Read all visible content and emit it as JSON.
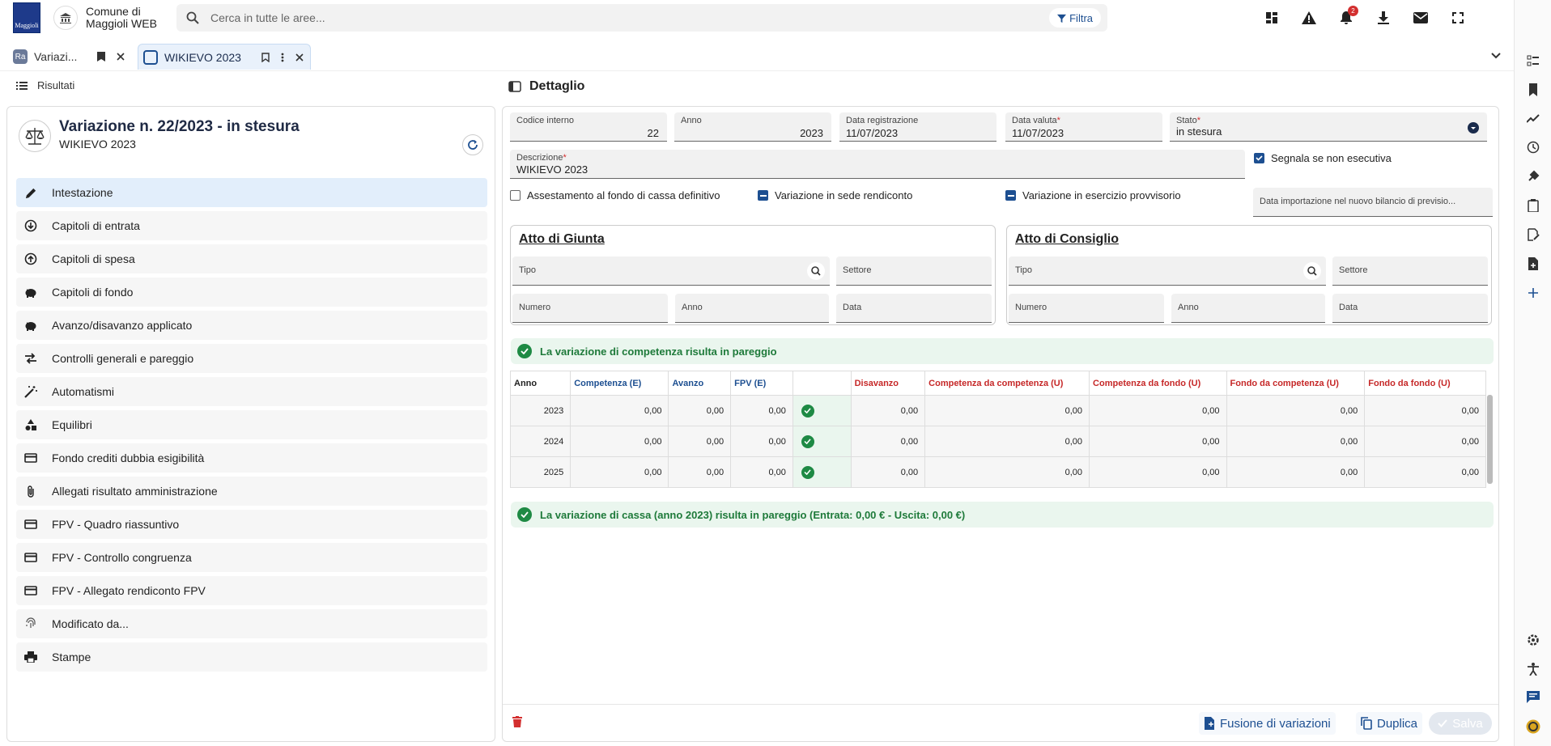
{
  "app": {
    "name_line1": "Comune di",
    "name_line2": "Maggioli WEB",
    "logo_text": "Maggioli"
  },
  "search": {
    "placeholder": "Cerca in tutte le aree...",
    "filter_label": "Filtra"
  },
  "notifications": {
    "count": "2"
  },
  "tabs": [
    {
      "label": "Variazi...",
      "icon_text": "Ra"
    },
    {
      "label": "WIKIEVO 2023"
    }
  ],
  "left": {
    "header": "Risultati",
    "title": "Variazione n. 22/2023 - in stesura",
    "subtitle": "WIKIEVO 2023",
    "menu": [
      {
        "label": "Intestazione",
        "icon": "pencil-icon"
      },
      {
        "label": "Capitoli di entrata",
        "icon": "arrow-down-circle-icon"
      },
      {
        "label": "Capitoli di spesa",
        "icon": "arrow-up-circle-icon"
      },
      {
        "label": "Capitoli di fondo",
        "icon": "piggy-bank-icon"
      },
      {
        "label": "Avanzo/disavanzo applicato",
        "icon": "piggy-bank-icon"
      },
      {
        "label": "Controlli generali e pareggio",
        "icon": "swap-icon"
      },
      {
        "label": "Automatismi",
        "icon": "magic-wand-icon"
      },
      {
        "label": "Equilibri",
        "icon": "shapes-icon"
      },
      {
        "label": "Fondo crediti dubbia esigibilità",
        "icon": "card-icon"
      },
      {
        "label": "Allegati risultato amministrazione",
        "icon": "paperclip-icon"
      },
      {
        "label": "FPV - Quadro riassuntivo",
        "icon": "card-icon"
      },
      {
        "label": "FPV - Controllo congruenza",
        "icon": "card-icon"
      },
      {
        "label": "FPV - Allegato rendiconto FPV",
        "icon": "card-icon"
      },
      {
        "label": "Modificato da...",
        "icon": "fingerprint-icon"
      },
      {
        "label": "Stampe",
        "icon": "printer-icon"
      }
    ]
  },
  "detail": {
    "header": "Dettaglio",
    "fields": {
      "codice_label": "Codice interno",
      "codice_value": "22",
      "anno_label": "Anno",
      "anno_value": "2023",
      "data_reg_label": "Data registrazione",
      "data_reg_value": "11/07/2023",
      "data_val_label": "Data valuta",
      "data_val_value": "11/07/2023",
      "stato_label": "Stato",
      "stato_value": "in stesura",
      "descr_label": "Descrizione",
      "descr_value": "WIKIEVO 2023",
      "data_import_label": "Data importazione nel nuovo bilancio di previsio..."
    },
    "checks": {
      "segnala": "Segnala se non esecutiva",
      "assestamento": "Assestamento al fondo di cassa definitivo",
      "sede_rendiconto": "Variazione in sede rendiconto",
      "esercizio_provv": "Variazione in esercizio provvisorio"
    },
    "atto_giunta": {
      "title": "Atto di Giunta",
      "tipo": "Tipo",
      "settore": "Settore",
      "numero": "Numero",
      "anno": "Anno",
      "data": "Data"
    },
    "atto_consiglio": {
      "title": "Atto di Consiglio",
      "tipo": "Tipo",
      "settore": "Settore",
      "numero": "Numero",
      "anno": "Anno",
      "data": "Data"
    },
    "msg_competenza": "La variazione di competenza risulta in pareggio",
    "msg_cassa": "La variazione di cassa (anno 2023) risulta in pareggio (Entrata: 0,00 € - Uscita: 0,00 €)",
    "table": {
      "headers": [
        "Anno",
        "Competenza (E)",
        "Avanzo",
        "FPV (E)",
        "",
        "Disavanzo",
        "Competenza da competenza (U)",
        "Competenza da fondo (U)",
        "Fondo da competenza (U)",
        "Fondo da fondo (U)"
      ],
      "rows": [
        {
          "anno": "2023",
          "v": [
            "0,00",
            "0,00",
            "0,00",
            "0,00",
            "0,00",
            "0,00",
            "0,00",
            "0,00"
          ]
        },
        {
          "anno": "2024",
          "v": [
            "0,00",
            "0,00",
            "0,00",
            "0,00",
            "0,00",
            "0,00",
            "0,00",
            "0,00"
          ]
        },
        {
          "anno": "2025",
          "v": [
            "0,00",
            "0,00",
            "0,00",
            "0,00",
            "0,00",
            "0,00",
            "0,00",
            "0,00"
          ]
        }
      ]
    },
    "footer": {
      "fusione": "Fusione di variazioni",
      "duplica": "Duplica",
      "salva": "Salva"
    }
  },
  "colors": {
    "accent": "#1d4f91",
    "success": "#1e8a44",
    "required": "#d32f2f"
  }
}
